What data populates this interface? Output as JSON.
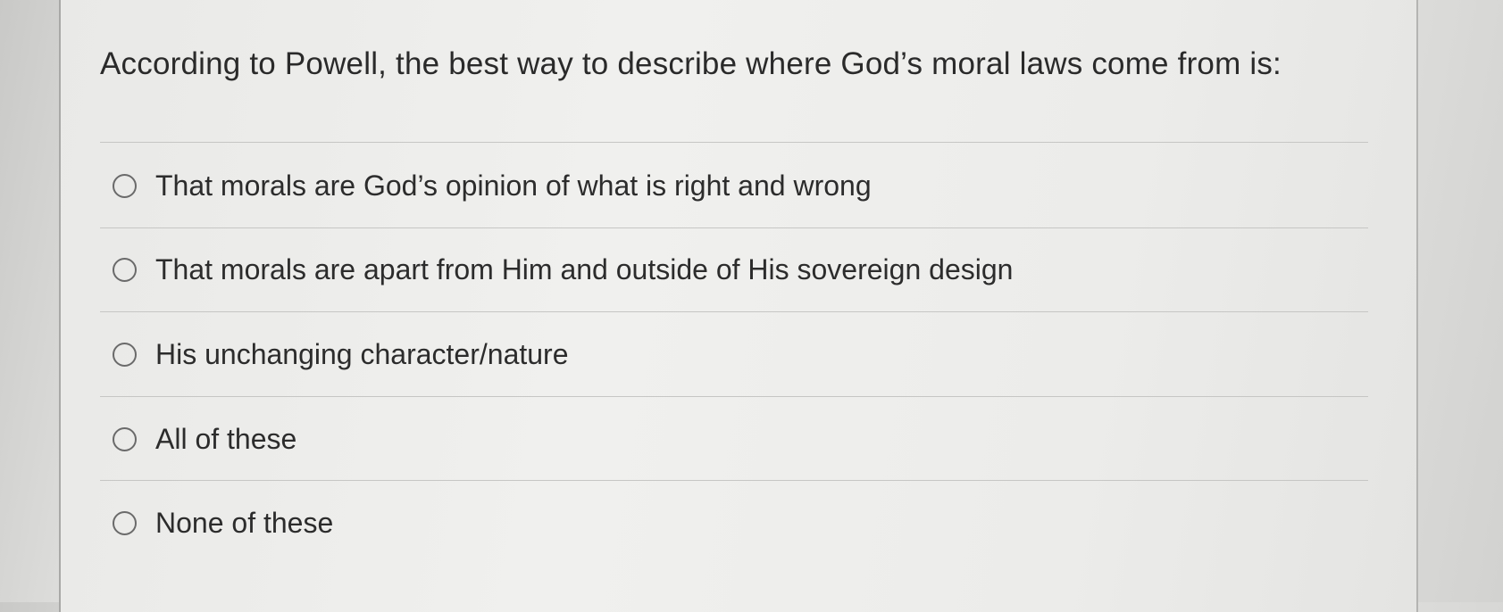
{
  "question": {
    "text": "According to Powell, the best way to describe where God’s moral laws come from is:"
  },
  "options": [
    {
      "label": "That morals are God’s opinion of what is right and wrong",
      "selected": false
    },
    {
      "label": "That morals are apart from Him and outside of His sovereign design",
      "selected": false
    },
    {
      "label": "His unchanging character/nature",
      "selected": false
    },
    {
      "label": "All of these",
      "selected": false
    },
    {
      "label": "None of these",
      "selected": false
    }
  ]
}
